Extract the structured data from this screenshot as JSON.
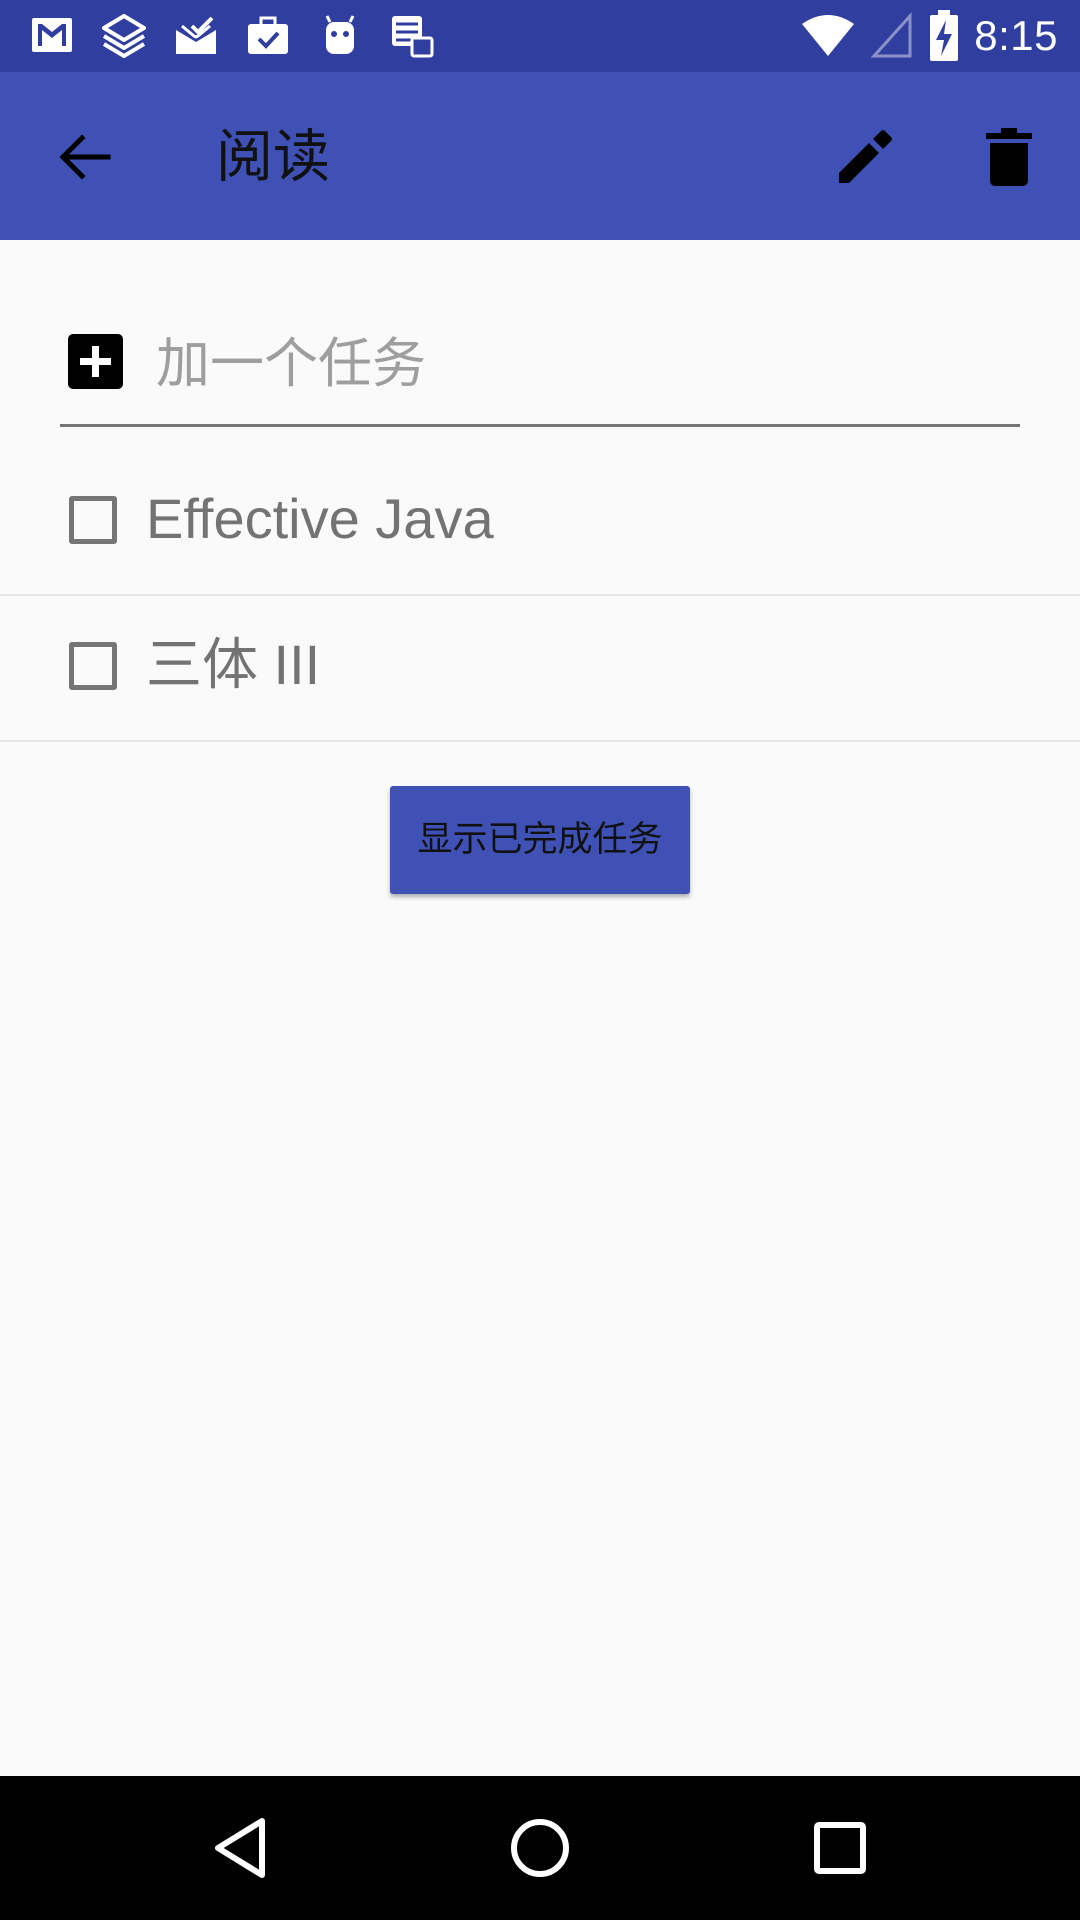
{
  "status_bar": {
    "time": "8:15",
    "left_icons": [
      "gmail-icon",
      "layers-icon",
      "mail-check-icon",
      "work-check-icon",
      "android-icon",
      "checklist-icon"
    ],
    "right_icons": [
      "wifi-icon",
      "signal-icon",
      "battery-charging-icon"
    ]
  },
  "app_bar": {
    "title": "阅读",
    "color": "#3f51b5",
    "status_color": "#303f9f",
    "icons": [
      "back-arrow-icon",
      "edit-pencil-icon",
      "trash-icon"
    ]
  },
  "add_task": {
    "placeholder": "加一个任务",
    "value": ""
  },
  "tasks": [
    {
      "label": "Effective Java",
      "checked": false
    },
    {
      "label": "三体 III",
      "checked": false
    }
  ],
  "show_completed_button": {
    "label": "显示已完成任务"
  },
  "nav_bar": {
    "icons": [
      "nav-back-icon",
      "nav-home-icon",
      "nav-recents-icon"
    ]
  }
}
